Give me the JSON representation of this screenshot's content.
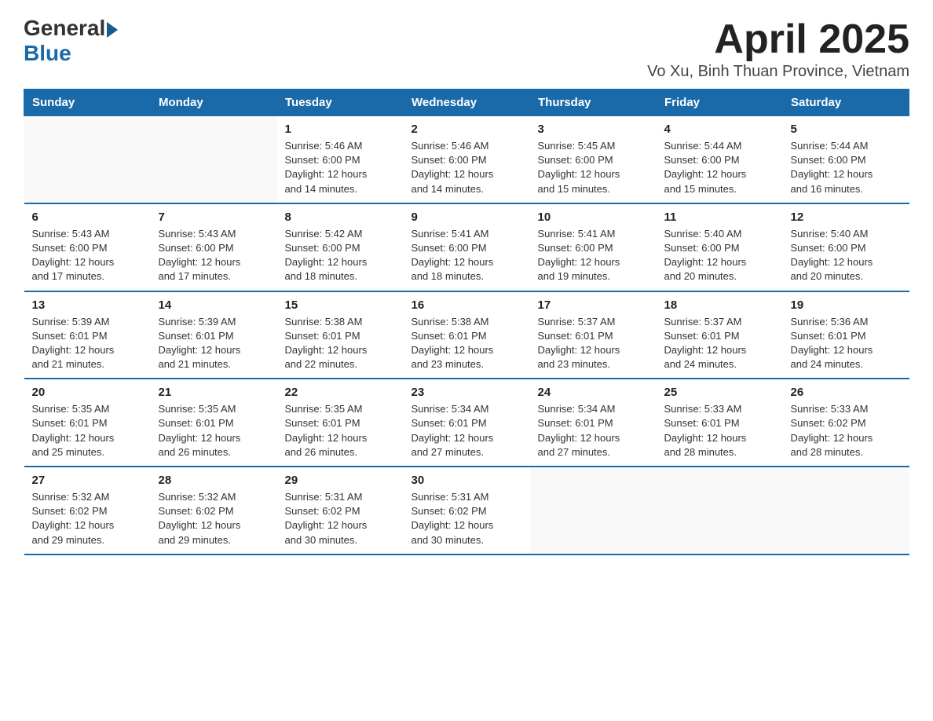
{
  "logo": {
    "general": "General",
    "blue": "Blue"
  },
  "header": {
    "title": "April 2025",
    "subtitle": "Vo Xu, Binh Thuan Province, Vietnam"
  },
  "weekdays": [
    "Sunday",
    "Monday",
    "Tuesday",
    "Wednesday",
    "Thursday",
    "Friday",
    "Saturday"
  ],
  "weeks": [
    [
      {
        "day": "",
        "info": ""
      },
      {
        "day": "",
        "info": ""
      },
      {
        "day": "1",
        "info": "Sunrise: 5:46 AM\nSunset: 6:00 PM\nDaylight: 12 hours\nand 14 minutes."
      },
      {
        "day": "2",
        "info": "Sunrise: 5:46 AM\nSunset: 6:00 PM\nDaylight: 12 hours\nand 14 minutes."
      },
      {
        "day": "3",
        "info": "Sunrise: 5:45 AM\nSunset: 6:00 PM\nDaylight: 12 hours\nand 15 minutes."
      },
      {
        "day": "4",
        "info": "Sunrise: 5:44 AM\nSunset: 6:00 PM\nDaylight: 12 hours\nand 15 minutes."
      },
      {
        "day": "5",
        "info": "Sunrise: 5:44 AM\nSunset: 6:00 PM\nDaylight: 12 hours\nand 16 minutes."
      }
    ],
    [
      {
        "day": "6",
        "info": "Sunrise: 5:43 AM\nSunset: 6:00 PM\nDaylight: 12 hours\nand 17 minutes."
      },
      {
        "day": "7",
        "info": "Sunrise: 5:43 AM\nSunset: 6:00 PM\nDaylight: 12 hours\nand 17 minutes."
      },
      {
        "day": "8",
        "info": "Sunrise: 5:42 AM\nSunset: 6:00 PM\nDaylight: 12 hours\nand 18 minutes."
      },
      {
        "day": "9",
        "info": "Sunrise: 5:41 AM\nSunset: 6:00 PM\nDaylight: 12 hours\nand 18 minutes."
      },
      {
        "day": "10",
        "info": "Sunrise: 5:41 AM\nSunset: 6:00 PM\nDaylight: 12 hours\nand 19 minutes."
      },
      {
        "day": "11",
        "info": "Sunrise: 5:40 AM\nSunset: 6:00 PM\nDaylight: 12 hours\nand 20 minutes."
      },
      {
        "day": "12",
        "info": "Sunrise: 5:40 AM\nSunset: 6:00 PM\nDaylight: 12 hours\nand 20 minutes."
      }
    ],
    [
      {
        "day": "13",
        "info": "Sunrise: 5:39 AM\nSunset: 6:01 PM\nDaylight: 12 hours\nand 21 minutes."
      },
      {
        "day": "14",
        "info": "Sunrise: 5:39 AM\nSunset: 6:01 PM\nDaylight: 12 hours\nand 21 minutes."
      },
      {
        "day": "15",
        "info": "Sunrise: 5:38 AM\nSunset: 6:01 PM\nDaylight: 12 hours\nand 22 minutes."
      },
      {
        "day": "16",
        "info": "Sunrise: 5:38 AM\nSunset: 6:01 PM\nDaylight: 12 hours\nand 23 minutes."
      },
      {
        "day": "17",
        "info": "Sunrise: 5:37 AM\nSunset: 6:01 PM\nDaylight: 12 hours\nand 23 minutes."
      },
      {
        "day": "18",
        "info": "Sunrise: 5:37 AM\nSunset: 6:01 PM\nDaylight: 12 hours\nand 24 minutes."
      },
      {
        "day": "19",
        "info": "Sunrise: 5:36 AM\nSunset: 6:01 PM\nDaylight: 12 hours\nand 24 minutes."
      }
    ],
    [
      {
        "day": "20",
        "info": "Sunrise: 5:35 AM\nSunset: 6:01 PM\nDaylight: 12 hours\nand 25 minutes."
      },
      {
        "day": "21",
        "info": "Sunrise: 5:35 AM\nSunset: 6:01 PM\nDaylight: 12 hours\nand 26 minutes."
      },
      {
        "day": "22",
        "info": "Sunrise: 5:35 AM\nSunset: 6:01 PM\nDaylight: 12 hours\nand 26 minutes."
      },
      {
        "day": "23",
        "info": "Sunrise: 5:34 AM\nSunset: 6:01 PM\nDaylight: 12 hours\nand 27 minutes."
      },
      {
        "day": "24",
        "info": "Sunrise: 5:34 AM\nSunset: 6:01 PM\nDaylight: 12 hours\nand 27 minutes."
      },
      {
        "day": "25",
        "info": "Sunrise: 5:33 AM\nSunset: 6:01 PM\nDaylight: 12 hours\nand 28 minutes."
      },
      {
        "day": "26",
        "info": "Sunrise: 5:33 AM\nSunset: 6:02 PM\nDaylight: 12 hours\nand 28 minutes."
      }
    ],
    [
      {
        "day": "27",
        "info": "Sunrise: 5:32 AM\nSunset: 6:02 PM\nDaylight: 12 hours\nand 29 minutes."
      },
      {
        "day": "28",
        "info": "Sunrise: 5:32 AM\nSunset: 6:02 PM\nDaylight: 12 hours\nand 29 minutes."
      },
      {
        "day": "29",
        "info": "Sunrise: 5:31 AM\nSunset: 6:02 PM\nDaylight: 12 hours\nand 30 minutes."
      },
      {
        "day": "30",
        "info": "Sunrise: 5:31 AM\nSunset: 6:02 PM\nDaylight: 12 hours\nand 30 minutes."
      },
      {
        "day": "",
        "info": ""
      },
      {
        "day": "",
        "info": ""
      },
      {
        "day": "",
        "info": ""
      }
    ]
  ]
}
